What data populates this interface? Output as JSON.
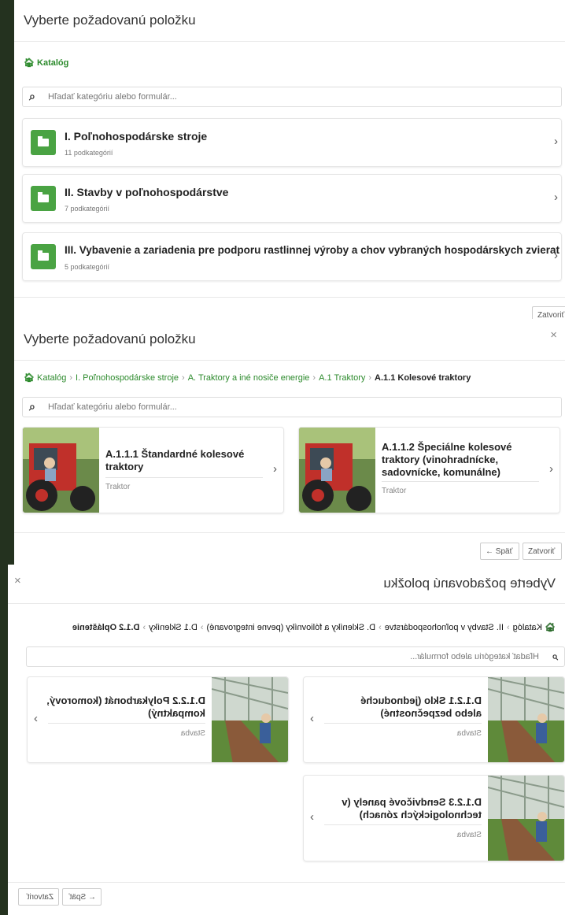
{
  "dialog_title": "Vyberte požadovanú položku",
  "search_placeholder": "Hľadať kategóriu alebo formulár...",
  "panel1": {
    "breadcrumb": [
      "Katalóg"
    ],
    "categories": [
      {
        "name": "I. Poľnohospodárske stroje",
        "sub": "11 podkategórií"
      },
      {
        "name": "II. Stavby v poľnohospodárstve",
        "sub": "7 podkategórií"
      },
      {
        "name": "III. Vybavenie a zariadenia pre podporu rastlinnej výroby a chov vybraných hospodárskych zvierat",
        "sub": "5 podkategórií"
      }
    ],
    "close_label": "Zatvoriť"
  },
  "panel2": {
    "breadcrumb": [
      "Katalóg",
      "I. Poľnohospodárske stroje",
      "A. Traktory a iné nosiče energie",
      "A.1 Traktory",
      "A.1.1 Kolesové traktory"
    ],
    "items": [
      {
        "title": "A.1.1.1 Štandardné kolesové traktory",
        "type": "Traktor"
      },
      {
        "title": "A.1.1.2 Špeciálne kolesové traktory (vinohradnícke, sadovnícke, komunálne)",
        "type": "Traktor"
      }
    ],
    "back_label": "← Späť",
    "close_label": "Zatvoriť"
  },
  "panel3": {
    "breadcrumb": [
      "Katalóg",
      "II. Stavby v poľnohospodárstve",
      "D. Skleníky a fóliovníky (pevne integrované)",
      "D.1 Skleníky",
      "D.1.2 Opláštenie"
    ],
    "items": [
      {
        "title": "D.1.2.1 Sklo (jednoduché alebo bezpečnostné)",
        "type": "Stavba"
      },
      {
        "title": "D.1.2.2 Polykarbonát (komorový, kompaktný)",
        "type": "Stavba"
      },
      {
        "title": "D.1.2.3 Sendvičové panely (v technologických zónach)",
        "type": "Stavba"
      }
    ],
    "back_label": "← Späť",
    "close_label": "Zatvoriť"
  },
  "icons": {
    "home": "home-icon",
    "search": "search-icon",
    "folder": "folder-icon",
    "chevron": "chevron-right-icon",
    "close": "close-icon"
  },
  "colors": {
    "accent": "#4aa343",
    "link": "#2c8a2c",
    "background": "#24321f"
  }
}
